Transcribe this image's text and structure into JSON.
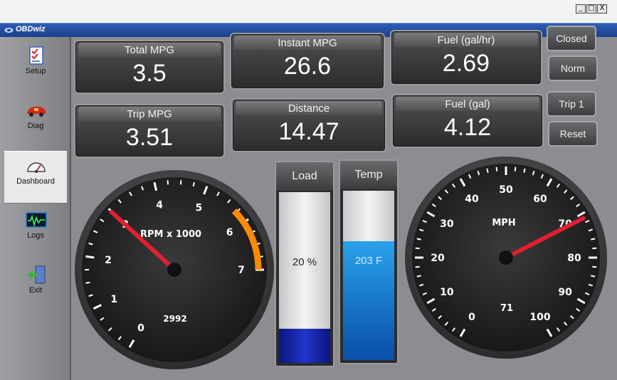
{
  "window": {
    "title": "OBDwiz",
    "controls": {
      "minimize": "_",
      "maximize": "□",
      "close": "X"
    }
  },
  "sidebar": {
    "items": [
      {
        "label": "Setup",
        "icon": "checklist-icon",
        "active": false
      },
      {
        "label": "Diag",
        "icon": "car-icon",
        "active": false
      },
      {
        "label": "Dashboard",
        "icon": "gauge-icon",
        "active": true
      },
      {
        "label": "Logs",
        "icon": "waveform-icon",
        "active": false
      },
      {
        "label": "Exit",
        "icon": "exit-door-icon",
        "active": false
      }
    ]
  },
  "readouts": {
    "total_mpg": {
      "label": "Total MPG",
      "value": "3.5"
    },
    "instant_mpg": {
      "label": "Instant MPG",
      "value": "26.6"
    },
    "fuel_rate": {
      "label": "Fuel (gal/hr)",
      "value": "2.69"
    },
    "trip_mpg": {
      "label": "Trip MPG",
      "value": "3.51"
    },
    "distance": {
      "label": "Distance",
      "value": "14.47"
    },
    "fuel_gal": {
      "label": "Fuel (gal)",
      "value": "4.12"
    }
  },
  "buttons": {
    "closed": "Closed",
    "norm": "Norm",
    "trip": "Trip 1",
    "reset": "Reset"
  },
  "bars": {
    "load": {
      "label": "Load",
      "text": "20 %",
      "fraction": 0.2,
      "fill_color": "#1020a0",
      "text_color": "#222222"
    },
    "temp": {
      "label": "Temp",
      "text": "203 F",
      "fraction": 0.7,
      "fill_color": "#1b86d6",
      "text_color": "#cfe6ff"
    }
  },
  "rpm_gauge": {
    "title": "RPM x 1000",
    "readout": "2992",
    "min": 0,
    "max": 7,
    "ticks": [
      "0",
      "1",
      "2",
      "3",
      "4",
      "5",
      "6",
      "7"
    ],
    "value": 2.992,
    "needle_color": "#e02030",
    "redline_from": 5.7
  },
  "mph_gauge": {
    "title": "MPH",
    "readout": "71",
    "min": 0,
    "max": 100,
    "ticks": [
      "0",
      "10",
      "20",
      "30",
      "40",
      "50",
      "60",
      "70",
      "80",
      "90",
      "100"
    ],
    "value": 71,
    "needle_color": "#e02030"
  }
}
